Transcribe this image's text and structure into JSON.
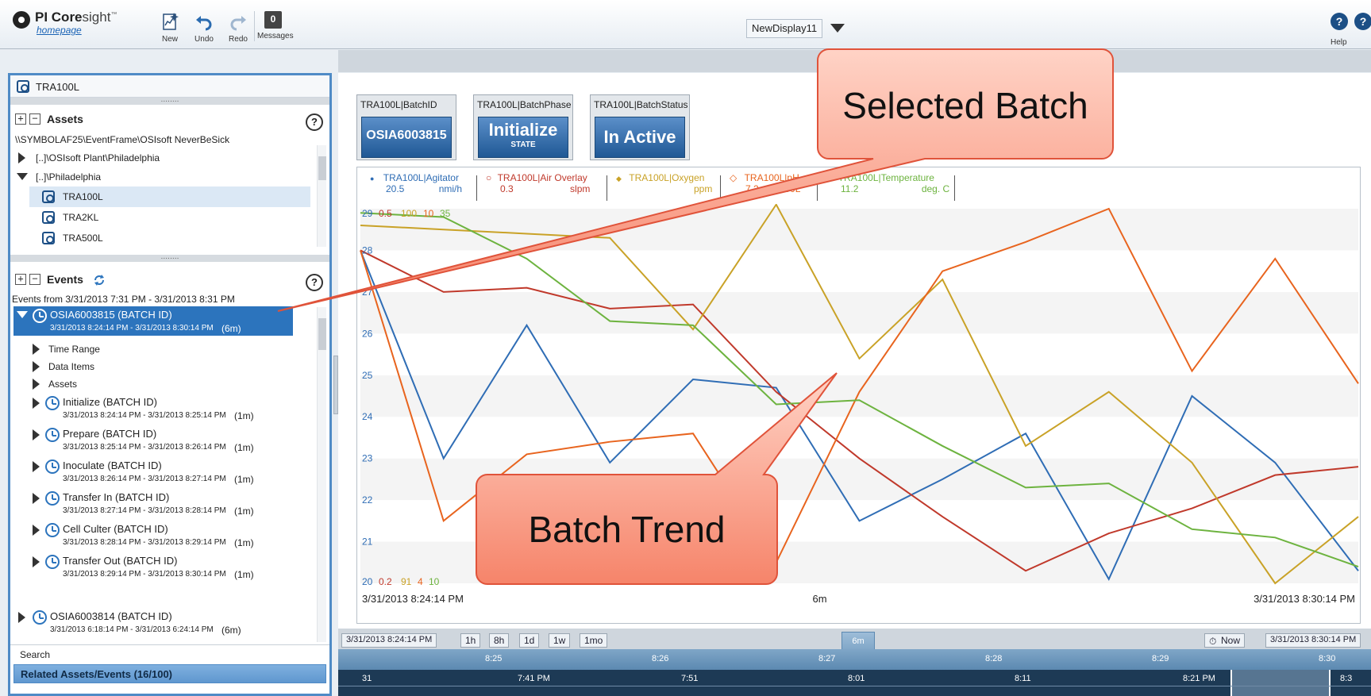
{
  "app": {
    "name": "PI Core",
    "name_suffix": "sight",
    "tm": "™",
    "homepage": "homepage"
  },
  "toolbar": {
    "new": "New",
    "undo": "Undo",
    "redo": "Redo",
    "messages": "Messages",
    "messages_badge": "0"
  },
  "display": {
    "name": "NewDisplay11"
  },
  "help": {
    "label": "Help",
    "icon": "?"
  },
  "assets_pane": {
    "selected_asset": "TRA100L",
    "title": "Assets",
    "path": "\\\\SYMBOLAF25\\EventFrame\\OSIsoft NeverBeSick",
    "tree": [
      {
        "label": "[..]\\OSIsoft Plant\\Philadelphia"
      },
      {
        "label": "[..]\\Philadelphia"
      },
      {
        "label": "TRA100L"
      },
      {
        "label": "TRA2KL"
      },
      {
        "label": "TRA500L"
      }
    ]
  },
  "events_pane": {
    "title": "Events",
    "range": "Events from 3/31/2013 7:31 PM - 3/31/2013 8:31 PM",
    "selected": {
      "title": "OSIA6003815  (BATCH ID)",
      "time": "3/31/2013 8:24:14 PM - 3/31/2013 8:30:14 PM",
      "dur": "(6m)"
    },
    "children": [
      "Time Range",
      "Data Items",
      "Assets"
    ],
    "sub_events": [
      {
        "title": "Initialize  (BATCH ID)",
        "time": "3/31/2013 8:24:14 PM - 3/31/2013 8:25:14 PM",
        "dur": "(1m)"
      },
      {
        "title": "Prepare  (BATCH ID)",
        "time": "3/31/2013 8:25:14 PM - 3/31/2013 8:26:14 PM",
        "dur": "(1m)"
      },
      {
        "title": "Inoculate  (BATCH ID)",
        "time": "3/31/2013 8:26:14 PM - 3/31/2013 8:27:14 PM",
        "dur": "(1m)"
      },
      {
        "title": "Transfer In  (BATCH ID)",
        "time": "3/31/2013 8:27:14 PM - 3/31/2013 8:28:14 PM",
        "dur": "(1m)"
      },
      {
        "title": "Cell Culter  (BATCH ID)",
        "time": "3/31/2013 8:28:14 PM - 3/31/2013 8:29:14 PM",
        "dur": "(1m)"
      },
      {
        "title": "Transfer Out  (BATCH ID)",
        "time": "3/31/2013 8:29:14 PM - 3/31/2013 8:30:14 PM",
        "dur": "(1m)"
      }
    ],
    "next": {
      "title": "OSIA6003814  (BATCH ID)",
      "time": "3/31/2013 6:18:14 PM - 3/31/2013 6:24:14 PM",
      "dur": "(6m)"
    },
    "search": "Search",
    "related": "Related Assets/Events (16/100)"
  },
  "value_boxes": [
    {
      "label": "TRA100L|BatchID",
      "value": "OSIA6003815",
      "sub": ""
    },
    {
      "label": "TRA100L|BatchPhase",
      "value": "Initialize",
      "sub": "STATE"
    },
    {
      "label": "TRA100L|BatchStatus",
      "value": "In Active",
      "sub": ""
    }
  ],
  "legend": [
    {
      "name": "TRA100L|Agitator",
      "value": "20.5",
      "unit": "nmi/h",
      "color": "#2f6db5",
      "marker": "●"
    },
    {
      "name": "TRA100L|Air Overlay",
      "value": "0.3",
      "unit": "slpm",
      "color": "#c0392b",
      "marker": "○"
    },
    {
      "name": "TRA100L|Oxygen",
      "value": "",
      "unit": "ppm",
      "color": "#c9a227",
      "marker": "◆"
    },
    {
      "name": "TRA100L|pH",
      "value": "7.2",
      "unit": "pH 100L",
      "color": "#e8641e",
      "marker": "◇"
    },
    {
      "name": "TRA100L|Temperature",
      "value": "11.2",
      "unit": "deg. C",
      "color": "#6db33f",
      "marker": "■"
    }
  ],
  "axis": {
    "top_values": [
      "29",
      "0.5",
      "100",
      "10",
      "35"
    ],
    "bottom_values": [
      "20",
      "0.2",
      "91",
      "4",
      "10"
    ],
    "start": "3/31/2013 8:24:14 PM",
    "mid": "6m",
    "end": "3/31/2013 8:30:14 PM"
  },
  "timebar": {
    "start": "3/31/2013 8:24:14 PM",
    "buttons": [
      "1h",
      "8h",
      "1d",
      "1w",
      "1mo"
    ],
    "duration": "6m",
    "now": "Now",
    "end": "3/31/2013 8:30:14 PM",
    "ticks": [
      "8:25",
      "8:26",
      "8:27",
      "8:28",
      "8:29",
      "8:30"
    ],
    "overview_ticks": [
      "31",
      "7:41 PM",
      "7:51",
      "8:01",
      "8:11",
      "8:21 PM",
      "8:3"
    ]
  },
  "callouts": {
    "selected": "Selected Batch",
    "trend": "Batch Trend"
  },
  "chart_data": {
    "type": "line",
    "x": [
      0,
      1,
      2,
      3,
      4,
      5,
      6,
      7,
      8,
      9,
      10,
      11,
      12
    ],
    "ylim": [
      20,
      29
    ],
    "yticks": [
      20,
      21,
      22,
      23,
      24,
      25,
      26,
      27,
      28,
      29
    ],
    "series": [
      {
        "name": "TRA100L|Agitator",
        "color": "#2f6db5",
        "values": [
          28.0,
          23.0,
          26.2,
          22.9,
          24.9,
          24.7,
          21.5,
          22.5,
          23.6,
          20.1,
          24.5,
          22.9,
          20.3
        ]
      },
      {
        "name": "TRA100L|Air Overlay",
        "color": "#c0392b",
        "values": [
          28.0,
          27.0,
          27.1,
          26.6,
          26.7,
          24.6,
          23.0,
          21.6,
          20.3,
          21.2,
          21.8,
          22.6,
          22.8
        ]
      },
      {
        "name": "TRA100L|Oxygen",
        "color": "#c9a227",
        "values": [
          28.6,
          28.5,
          28.4,
          28.3,
          26.1,
          29.1,
          25.4,
          27.3,
          23.3,
          24.6,
          22.9,
          20.0,
          21.6
        ]
      },
      {
        "name": "TRA100L|pH",
        "color": "#e8641e",
        "values": [
          28.0,
          21.5,
          23.1,
          23.4,
          23.6,
          20.5,
          24.6,
          27.5,
          28.2,
          29.0,
          25.1,
          27.8,
          24.8
        ]
      },
      {
        "name": "TRA100L|Temperature",
        "color": "#6db33f",
        "values": [
          28.9,
          28.8,
          27.8,
          26.3,
          26.2,
          24.3,
          24.4,
          23.3,
          22.3,
          22.4,
          21.3,
          21.1,
          20.4
        ]
      }
    ]
  }
}
